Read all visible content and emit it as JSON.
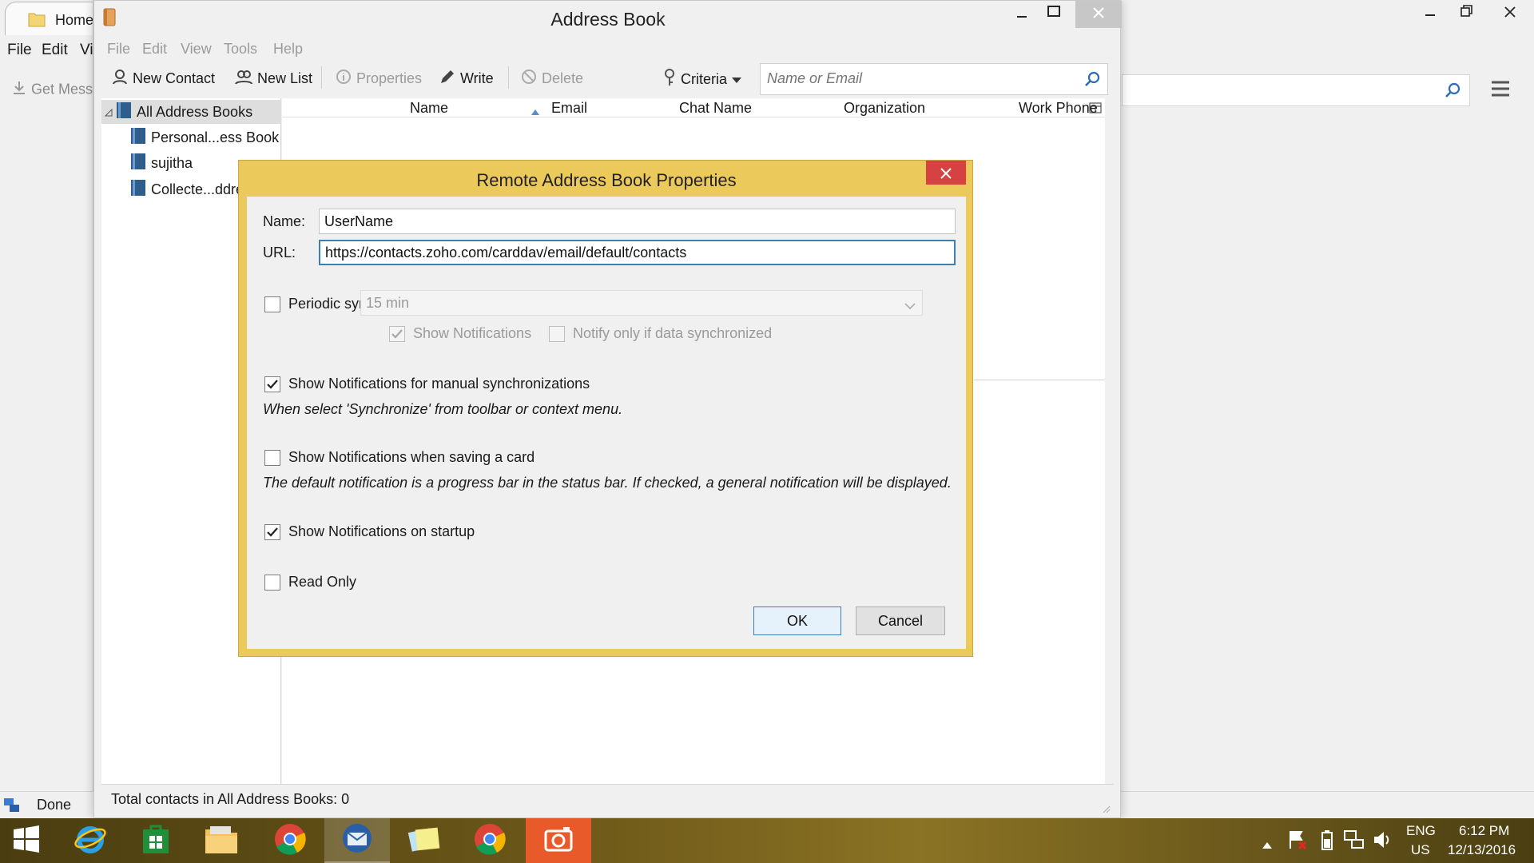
{
  "background_window": {
    "tab_label": "Home",
    "menu": [
      "File",
      "Edit",
      "Vi"
    ],
    "get_messages_label": "Get Mess",
    "status_text": "Done"
  },
  "address_book": {
    "title": "Address Book",
    "menu": [
      "File",
      "Edit",
      "View",
      "Tools",
      "Help"
    ],
    "toolbar": {
      "new_contact": "New Contact",
      "new_list": "New List",
      "properties": "Properties",
      "write": "Write",
      "delete": "Delete",
      "criteria": "Criteria"
    },
    "search_placeholder": "Name or Email",
    "tree": [
      {
        "label": "All Address Books"
      },
      {
        "label": "Personal...ess Book"
      },
      {
        "label": "sujitha"
      },
      {
        "label": "Collecte...ddre"
      }
    ],
    "columns": [
      "Name",
      "Email",
      "Chat Name",
      "Organization",
      "Work Phone"
    ],
    "status_text": "Total contacts in All Address Books: 0"
  },
  "dialog": {
    "title": "Remote Address Book Properties",
    "name_label": "Name:",
    "name_value": "UserName",
    "url_label": "URL:",
    "url_value": "https://contacts.zoho.com/carddav/email/default/contacts",
    "periodic_sync_label": "Periodic sync",
    "periodic_sync_checked": false,
    "sync_interval": "15 min",
    "show_notifications_label": "Show Notifications",
    "notify_only_label": "Notify only if data synchronized",
    "manual_sync_label": "Show Notifications for manual synchronizations",
    "manual_sync_checked": true,
    "manual_sync_note": "When select 'Synchronize' from toolbar or context menu.",
    "saving_card_label": "Show Notifications when saving a card",
    "saving_card_checked": false,
    "saving_card_note": "The default notification is a progress bar in the status bar. If checked, a general notification will be displayed.",
    "startup_label": "Show Notifications on startup",
    "startup_checked": true,
    "read_only_label": "Read Only",
    "read_only_checked": false,
    "ok_label": "OK",
    "cancel_label": "Cancel"
  },
  "taskbar": {
    "lang_line1": "ENG",
    "lang_line2": "US",
    "time": "6:12 PM",
    "date": "12/13/2016"
  },
  "colors": {
    "dialog_frame": "#ecc95b",
    "close_button": "#d64242",
    "default_button_border": "#3c7fb1"
  }
}
